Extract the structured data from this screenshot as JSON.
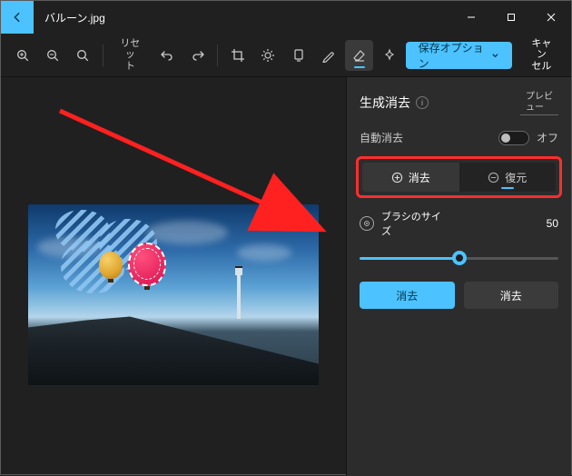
{
  "titlebar": {
    "filename": "バルーン.jpg"
  },
  "toolbar": {
    "reset_label": "リセッ\nト",
    "save_label": "保存オプション",
    "cancel_label": "キャン\nセル"
  },
  "panel": {
    "title": "生成消去",
    "preview_badge": "プレビュー",
    "auto_erase_label": "自動消去",
    "auto_erase_state": "オフ",
    "erase_label": "消去",
    "restore_label": "復元",
    "brush_label": "ブラシのサイ\nズ",
    "brush_value": "50",
    "apply_label": "消去",
    "cancel_label": "消去"
  },
  "colors": {
    "accent": "#4cc2ff",
    "highlight_border": "#ff2e2e"
  },
  "slider": {
    "min": 0,
    "max": 100,
    "value": 50
  }
}
